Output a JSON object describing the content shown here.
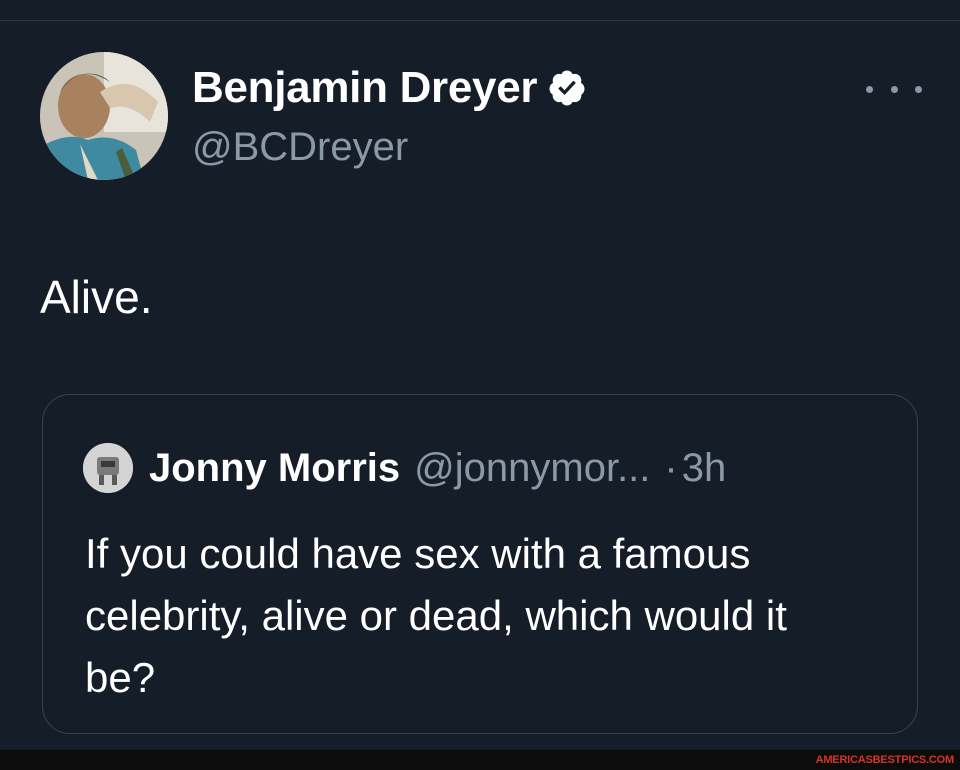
{
  "tweet": {
    "author": {
      "display_name": "Benjamin Dreyer",
      "handle": "@BCDreyer",
      "verified": true,
      "avatar_icon": "person-avatar"
    },
    "more_icon": "more-dots-icon",
    "text": "Alive.",
    "quote": {
      "author": {
        "display_name": "Jonny Morris",
        "handle": "@jonnymor...",
        "avatar_icon": "person-avatar"
      },
      "separator": "·",
      "time": "3h",
      "text": "If you could have sex with a famous celebrity, alive or dead, which would it be?"
    }
  },
  "watermark": "AMERICASBESTPICS.COM",
  "colors": {
    "background": "#151d29",
    "primary_text": "#ffffff",
    "secondary_text": "#8b98a5",
    "border": "#38444d",
    "watermark": "#d6332b"
  }
}
